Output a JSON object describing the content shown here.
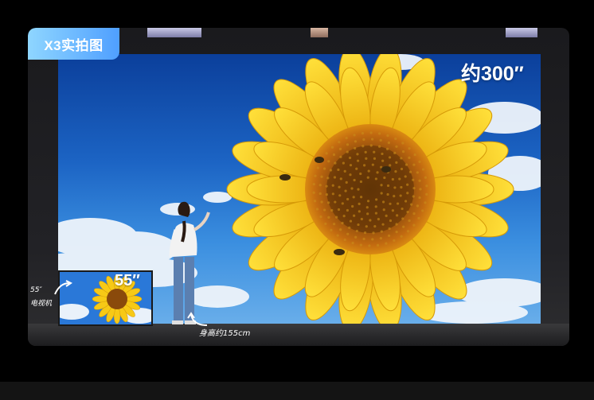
{
  "badge": {
    "label": "X3实拍图"
  },
  "screen": {
    "size_label": "约300″"
  },
  "tv": {
    "size_label": "55″",
    "label_line1": "55″",
    "label_line2": "电视机"
  },
  "person": {
    "height_label": "身高约155cm"
  },
  "colors": {
    "badge_start": "#8fd6ff",
    "badge_end": "#4f9fff",
    "sky": "#1c64c4",
    "petal": "#f7c916",
    "center": "#8a4a0b"
  },
  "icons": {
    "arrow_tv": "curved-arrow-icon",
    "arrow_person": "curved-arrow-icon"
  }
}
